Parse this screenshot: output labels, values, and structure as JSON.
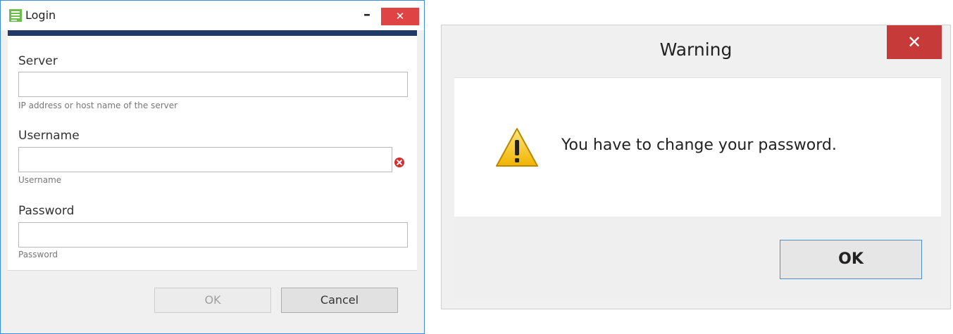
{
  "login": {
    "title": "Login",
    "minimize_glyph": "–",
    "close_glyph": "✕",
    "server": {
      "label": "Server",
      "value": "",
      "hint": "IP address or host name of the server"
    },
    "username": {
      "label": "Username",
      "value": "",
      "hint": "Username"
    },
    "password": {
      "label": "Password",
      "value": "",
      "hint": "Password"
    },
    "ok_label": "OK",
    "cancel_label": "Cancel"
  },
  "warning": {
    "title": "Warning",
    "close_glyph": "✕",
    "message": "You have to change your password.",
    "ok_label": "OK"
  },
  "icons": {
    "app": "list-app-icon",
    "validation": "error-icon",
    "warning": "warning-triangle-icon"
  },
  "colors": {
    "window_border": "#3c8dde",
    "accent_bar": "#1f3a66",
    "close_red": "#e04343",
    "warning_close_red": "#c73a3a",
    "error_red": "#d32f2f",
    "focus_blue": "#4a90d9"
  }
}
